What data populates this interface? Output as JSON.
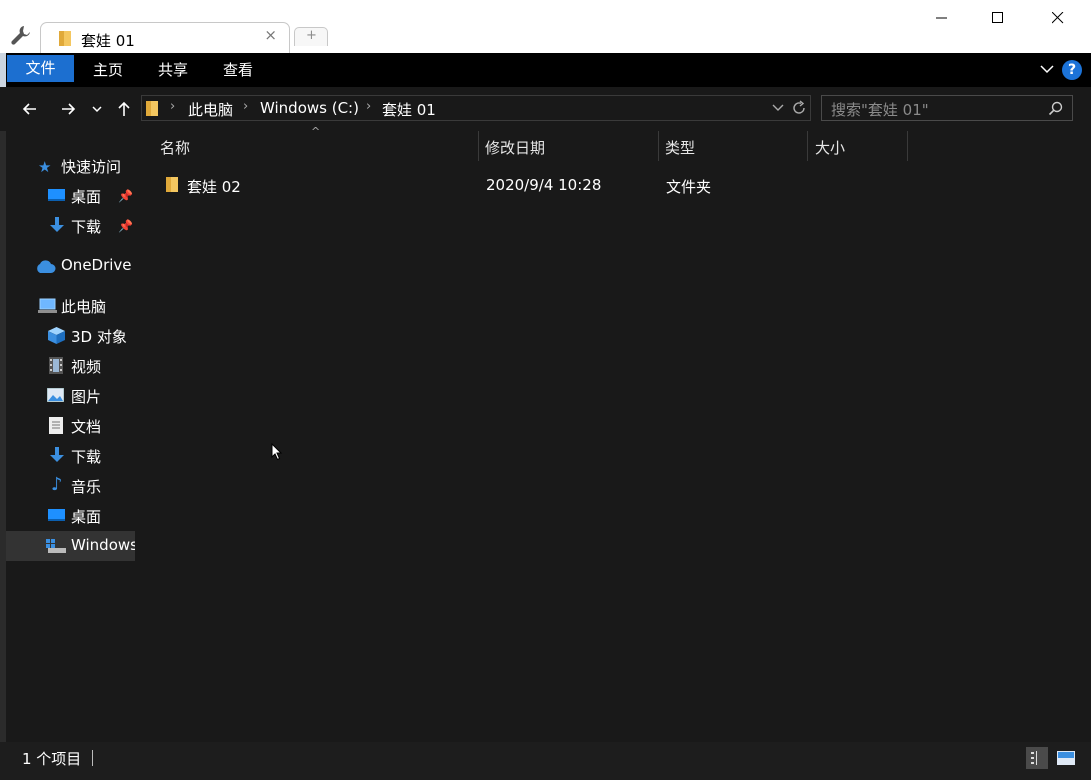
{
  "tab": {
    "title": "套娃 01"
  },
  "ribbon": {
    "tabs": [
      "文件",
      "主页",
      "共享",
      "查看"
    ]
  },
  "address": {
    "breadcrumbs": [
      "此电脑",
      "Windows (C:)",
      "套娃 01"
    ],
    "search_placeholder": "搜索\"套娃 01\""
  },
  "sidebar": {
    "items": [
      {
        "label": "快速访问",
        "icon": "star-icon"
      },
      {
        "label": "桌面",
        "icon": "desktop-icon",
        "pinned": true
      },
      {
        "label": "下载",
        "icon": "download-icon",
        "pinned": true
      },
      {
        "label": "OneDrive",
        "icon": "cloud-icon"
      },
      {
        "label": "此电脑",
        "icon": "computer-icon"
      },
      {
        "label": "3D 对象",
        "icon": "cube-icon"
      },
      {
        "label": "视频",
        "icon": "video-icon"
      },
      {
        "label": "图片",
        "icon": "picture-icon"
      },
      {
        "label": "文档",
        "icon": "document-icon"
      },
      {
        "label": "下载",
        "icon": "download-icon"
      },
      {
        "label": "音乐",
        "icon": "music-icon"
      },
      {
        "label": "桌面",
        "icon": "desktop-icon"
      },
      {
        "label": "Windows",
        "icon": "drive-icon",
        "selected": true
      }
    ]
  },
  "columns": {
    "name": "名称",
    "date": "修改日期",
    "type": "类型",
    "size": "大小"
  },
  "rows": [
    {
      "name": "套娃 02",
      "date": "2020/9/4 10:28",
      "type": "文件夹",
      "size": ""
    }
  ],
  "status": {
    "count_text": "1 个项目"
  },
  "colors": {
    "accent": "#1c6fd0",
    "background": "#191919",
    "folder": "#f4c760"
  }
}
